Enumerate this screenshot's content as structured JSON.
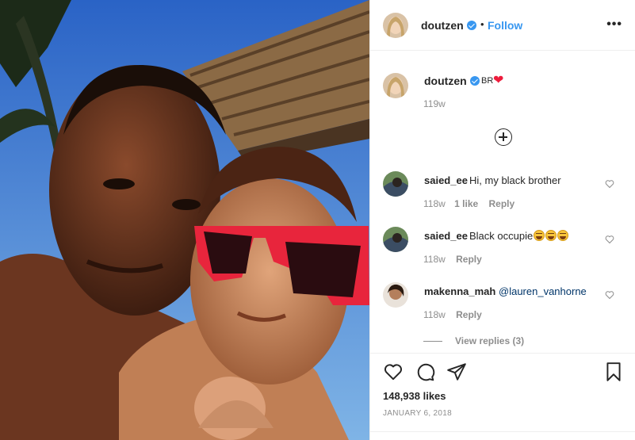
{
  "post": {
    "username": "doutzen",
    "follow_label": "Follow",
    "separator": "•",
    "more_label": "•••"
  },
  "caption": {
    "username": "doutzen",
    "text": "BR",
    "time": "119w"
  },
  "comments": [
    {
      "username": "saied_ee",
      "text": "Hi, my black brother",
      "time": "118w",
      "likes": "1 like",
      "reply": "Reply"
    },
    {
      "username": "saied_ee",
      "text": "Black occupie",
      "time": "118w",
      "reply": "Reply"
    },
    {
      "username": "makenna_mah",
      "text": "@lauren_vanhorne",
      "time": "118w",
      "reply": "Reply"
    }
  ],
  "view_replies": "View replies (3)",
  "likes_count": "148,938 likes",
  "date": "JANUARY 6, 2018",
  "colors": {
    "accent": "#3897f0",
    "heart": "#ed1c3c",
    "muted": "#8e8e8e"
  }
}
